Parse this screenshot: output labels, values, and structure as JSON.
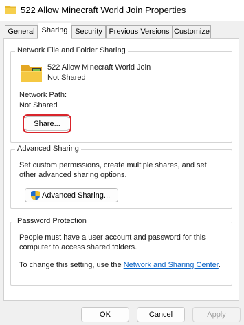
{
  "window": {
    "title": "522 Allow Minecraft World Join Properties"
  },
  "tabs": [
    {
      "label": "General"
    },
    {
      "label": "Sharing"
    },
    {
      "label": "Security"
    },
    {
      "label": "Previous Versions"
    },
    {
      "label": "Customize"
    }
  ],
  "active_tab": "Sharing",
  "network_sharing": {
    "legend": "Network File and Folder Sharing",
    "folder_name": "522 Allow Minecraft World Join",
    "folder_status": "Not Shared",
    "path_label": "Network Path:",
    "path_value": "Not Shared",
    "share_button": "Share..."
  },
  "advanced_sharing": {
    "legend": "Advanced Sharing",
    "description": "Set custom permissions, create multiple shares, and set other advanced sharing options.",
    "button": "Advanced Sharing..."
  },
  "password_protection": {
    "legend": "Password Protection",
    "description": "People must have a user account and password for this computer to access shared folders.",
    "change_prefix": "To change this setting, use the ",
    "link_text": "Network and Sharing Center",
    "change_suffix": "."
  },
  "footer": {
    "ok": "OK",
    "cancel": "Cancel",
    "apply": "Apply"
  },
  "colors": {
    "highlight_outline": "#d9242b",
    "link": "#0a63c7"
  }
}
